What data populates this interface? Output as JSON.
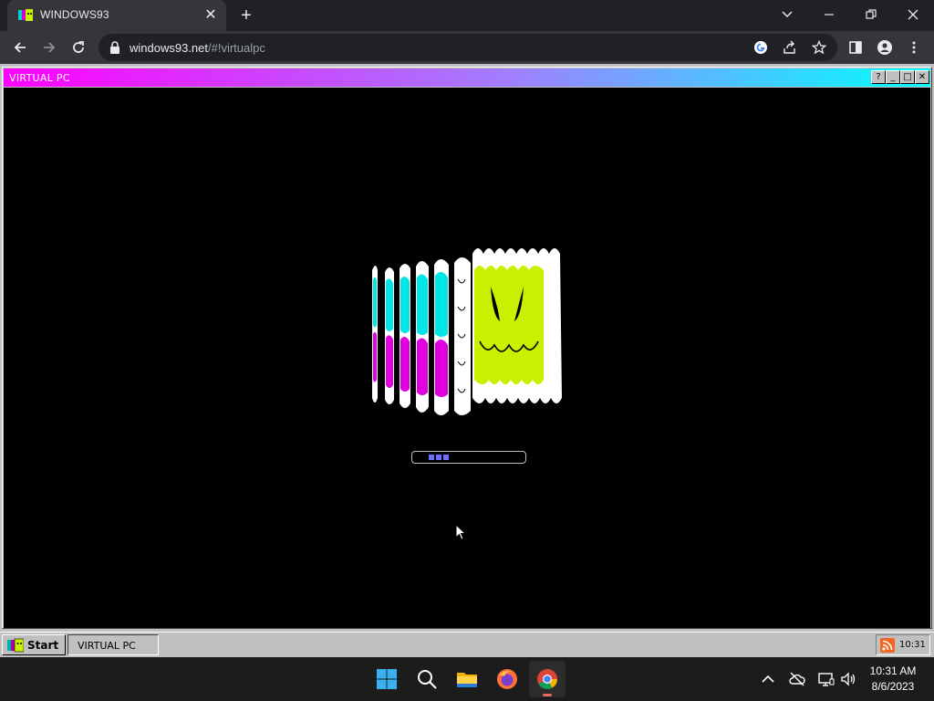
{
  "browser": {
    "tab_title": "WINDOWS93",
    "tab_close_glyph": "✕",
    "new_tab_glyph": "+",
    "url_host": "windows93.net",
    "url_path": "/#!virtualpc",
    "icons": [
      "back-arrow-icon",
      "forward-arrow-icon",
      "reload-icon",
      "lock-icon",
      "google-icon",
      "share-icon",
      "star-icon",
      "side-panel-icon",
      "profile-icon",
      "menu-dots-icon"
    ]
  },
  "vpc_window": {
    "title": "VIRTUAL PC",
    "btn_help": "?",
    "btn_min": "_",
    "btn_max": "□",
    "btn_close": "✕",
    "screen_color": "#000000",
    "boot_progress_blocks": 3
  },
  "w93_taskbar": {
    "start_label": "Start",
    "task_label": "VIRTUAL PC",
    "tray_time": "10:31"
  },
  "os_taskbar": {
    "clock_time": "10:31 AM",
    "clock_date": "8/6/2023",
    "apps": [
      "windows-start-icon",
      "search-icon",
      "file-explorer-icon",
      "firefox-icon",
      "chrome-icon"
    ]
  },
  "colors": {
    "title_gradient_start": "#ff00ff",
    "title_gradient_end": "#00ffff",
    "logo_cyan": "#00e5e5",
    "logo_magenta": "#e000e0",
    "logo_lime": "#c8f000"
  }
}
